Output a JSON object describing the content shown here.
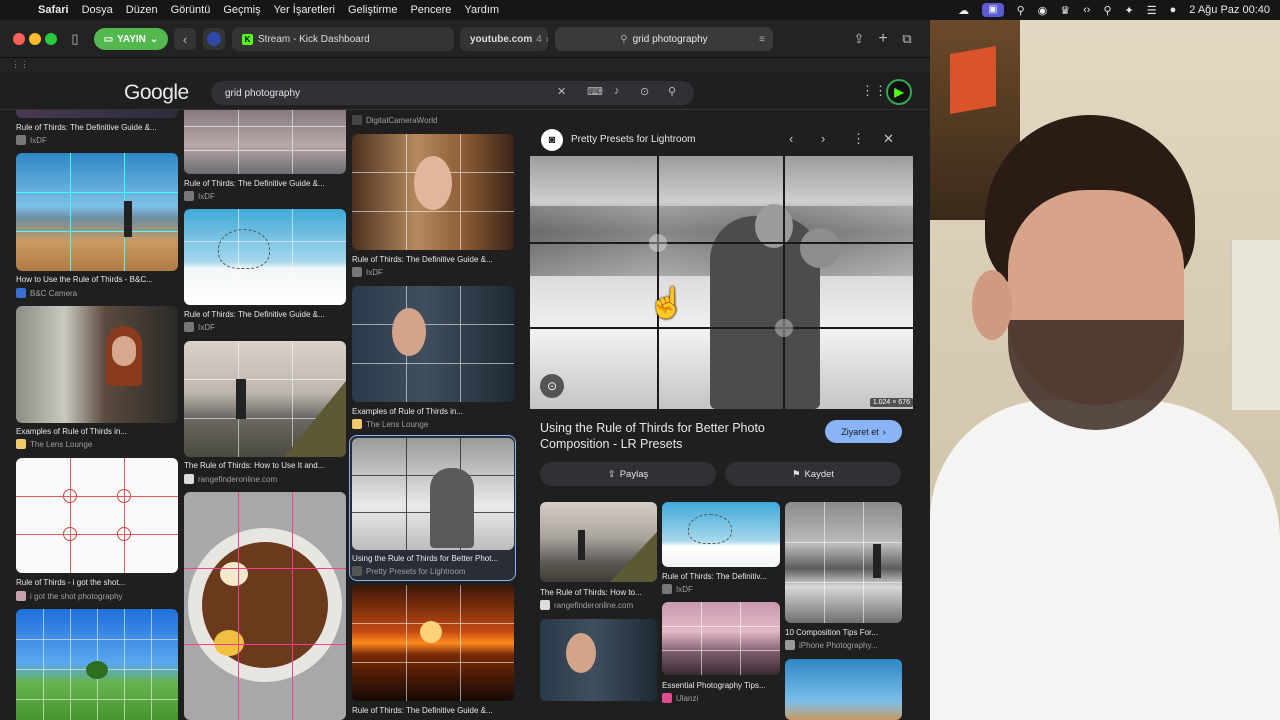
{
  "menubar": {
    "app": "Safari",
    "items": [
      "Dosya",
      "Düzen",
      "Görüntü",
      "Geçmiş",
      "Yer İşaretleri",
      "Geliştirme",
      "Pencere",
      "Yardım"
    ],
    "datetime": "2 Ağu Paz  00:40"
  },
  "toolbar": {
    "live_label": "YAYIN",
    "tab1": "Stream - Kick Dashboard",
    "tab2": "youtube.com",
    "tab2_count": "4",
    "address": "grid photography"
  },
  "google": {
    "logo": "Google",
    "query": "grid photography"
  },
  "results": {
    "col1": [
      {
        "title": "Rule of Thirds: The Definitive Guide &...",
        "source": "IxDF"
      },
      {
        "title": "How to Use the Rule of Thirds - B&C...",
        "source": "B&C Camera"
      },
      {
        "title": "Examples of Rule of Thirds in...",
        "source": "The Lens Lounge"
      },
      {
        "title": "Rule of Thirds - i got the shot...",
        "source": "i got the shot photography"
      }
    ],
    "col2": [
      {
        "title": "Rule of Thirds: The Definitive Guide &...",
        "source": "IxDF"
      },
      {
        "title": "Rule of Thirds: The Definitive Guide &...",
        "source": "IxDF"
      },
      {
        "title": "The Rule of Thirds: How to Use It and...",
        "source": "rangefinderonline.com"
      }
    ],
    "col3": [
      {
        "title": "",
        "source": "DigitalCameraWorld"
      },
      {
        "title": "Rule of Thirds: The Definitive Guide &...",
        "source": "IxDF"
      },
      {
        "title": "Examples of Rule of Thirds in...",
        "source": "The Lens Lounge"
      },
      {
        "title": "Using the Rule of Thirds for Better Phot...",
        "source": "Pretty Presets for Lightroom"
      },
      {
        "title": "Rule of Thirds: The Definitive Guide &...",
        "source": ""
      }
    ]
  },
  "preview": {
    "site": "Pretty Presets for Lightroom",
    "dimensions": "1.024 × 676",
    "heading": "Using the Rule of Thirds for Better Photo Composition - LR Presets",
    "visit_label": "Ziyaret et",
    "share_label": "Paylaş",
    "save_label": "Kaydet",
    "related": [
      {
        "title": "The Rule of Thirds: How to...",
        "source": "rangefinderonline.com"
      },
      {
        "title": "Rule of Thirds: The Definitiv...",
        "source": "IxDF"
      },
      {
        "title": "10 Composition Tips For...",
        "source": "iPhone Photography..."
      },
      {
        "title": "Essential Photography Tips...",
        "source": "Ulanzi"
      }
    ]
  },
  "colors": {
    "accent": "#8ab4f8",
    "live": "#53b84e"
  }
}
